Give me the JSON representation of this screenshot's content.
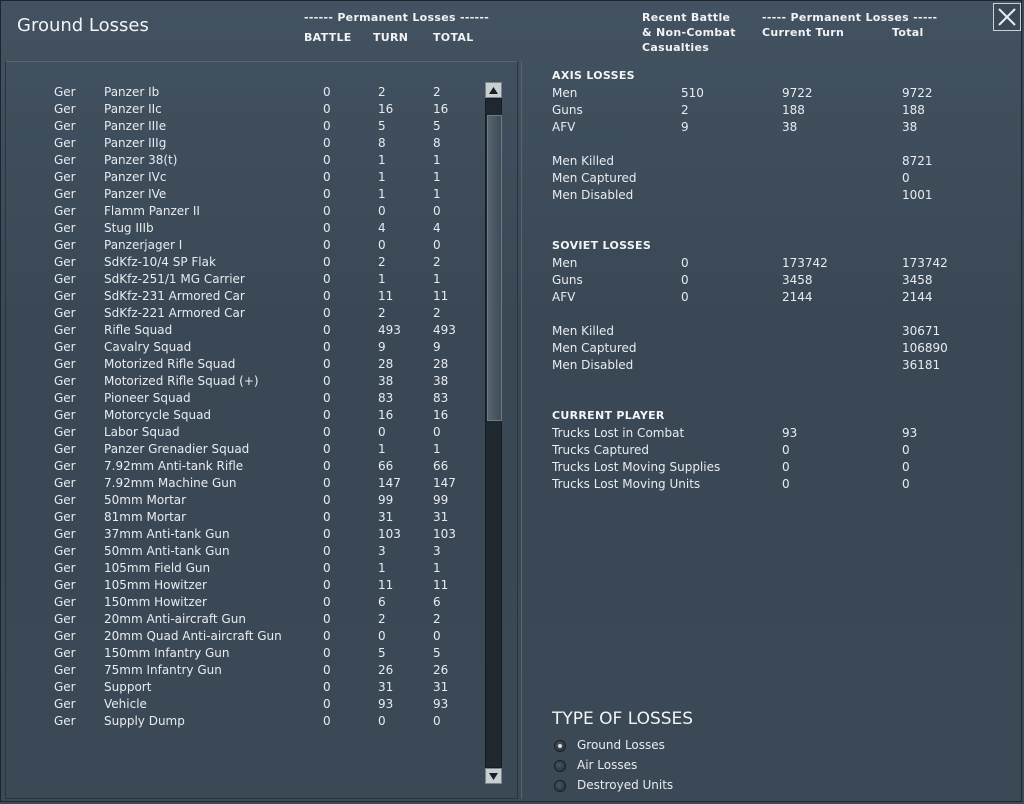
{
  "window": {
    "title": "Ground Losses"
  },
  "header": {
    "perm_losses_left": "------ Permanent Losses ------",
    "col_battle": "BATTLE",
    "col_turn": "TURN",
    "col_total": "TOTAL",
    "recent_line1": "Recent Battle",
    "recent_line2": "& Non-Combat",
    "recent_line3": "Casualties",
    "perm_losses_right": "----- Permanent Losses -----",
    "col_current_turn": "Current Turn",
    "col_total_right": "Total"
  },
  "close_icon": "close-icon",
  "units": [
    {
      "nation": "Ger",
      "name": "Panzer Ib",
      "battle": "0",
      "turn": "2",
      "total": "2"
    },
    {
      "nation": "Ger",
      "name": "Panzer IIc",
      "battle": "0",
      "turn": "16",
      "total": "16"
    },
    {
      "nation": "Ger",
      "name": "Panzer IIIe",
      "battle": "0",
      "turn": "5",
      "total": "5"
    },
    {
      "nation": "Ger",
      "name": "Panzer IIIg",
      "battle": "0",
      "turn": "8",
      "total": "8"
    },
    {
      "nation": "Ger",
      "name": "Panzer 38(t)",
      "battle": "0",
      "turn": "1",
      "total": "1"
    },
    {
      "nation": "Ger",
      "name": "Panzer IVc",
      "battle": "0",
      "turn": "1",
      "total": "1"
    },
    {
      "nation": "Ger",
      "name": "Panzer IVe",
      "battle": "0",
      "turn": "1",
      "total": "1"
    },
    {
      "nation": "Ger",
      "name": "Flamm Panzer II",
      "battle": "0",
      "turn": "0",
      "total": "0"
    },
    {
      "nation": "Ger",
      "name": "Stug IIIb",
      "battle": "0",
      "turn": "4",
      "total": "4"
    },
    {
      "nation": "Ger",
      "name": "Panzerjager I",
      "battle": "0",
      "turn": "0",
      "total": "0"
    },
    {
      "nation": "Ger",
      "name": "SdKfz-10/4 SP Flak",
      "battle": "0",
      "turn": "2",
      "total": "2"
    },
    {
      "nation": "Ger",
      "name": "SdKfz-251/1 MG Carrier",
      "battle": "0",
      "turn": "1",
      "total": "1"
    },
    {
      "nation": "Ger",
      "name": "SdKfz-231 Armored Car",
      "battle": "0",
      "turn": "11",
      "total": "11"
    },
    {
      "nation": "Ger",
      "name": "SdKfz-221 Armored Car",
      "battle": "0",
      "turn": "2",
      "total": "2"
    },
    {
      "nation": "Ger",
      "name": "Rifle Squad",
      "battle": "0",
      "turn": "493",
      "total": "493"
    },
    {
      "nation": "Ger",
      "name": "Cavalry Squad",
      "battle": "0",
      "turn": "9",
      "total": "9"
    },
    {
      "nation": "Ger",
      "name": "Motorized Rifle Squad",
      "battle": "0",
      "turn": "28",
      "total": "28"
    },
    {
      "nation": "Ger",
      "name": "Motorized Rifle Squad (+)",
      "battle": "0",
      "turn": "38",
      "total": "38"
    },
    {
      "nation": "Ger",
      "name": "Pioneer Squad",
      "battle": "0",
      "turn": "83",
      "total": "83"
    },
    {
      "nation": "Ger",
      "name": "Motorcycle Squad",
      "battle": "0",
      "turn": "16",
      "total": "16"
    },
    {
      "nation": "Ger",
      "name": "Labor Squad",
      "battle": "0",
      "turn": "0",
      "total": "0"
    },
    {
      "nation": "Ger",
      "name": "Panzer Grenadier Squad",
      "battle": "0",
      "turn": "1",
      "total": "1"
    },
    {
      "nation": "Ger",
      "name": "7.92mm Anti-tank Rifle",
      "battle": "0",
      "turn": "66",
      "total": "66"
    },
    {
      "nation": "Ger",
      "name": "7.92mm Machine Gun",
      "battle": "0",
      "turn": "147",
      "total": "147"
    },
    {
      "nation": "Ger",
      "name": "50mm Mortar",
      "battle": "0",
      "turn": "99",
      "total": "99"
    },
    {
      "nation": "Ger",
      "name": "81mm Mortar",
      "battle": "0",
      "turn": "31",
      "total": "31"
    },
    {
      "nation": "Ger",
      "name": "37mm Anti-tank Gun",
      "battle": "0",
      "turn": "103",
      "total": "103"
    },
    {
      "nation": "Ger",
      "name": "50mm Anti-tank Gun",
      "battle": "0",
      "turn": "3",
      "total": "3"
    },
    {
      "nation": "Ger",
      "name": "105mm Field Gun",
      "battle": "0",
      "turn": "1",
      "total": "1"
    },
    {
      "nation": "Ger",
      "name": "105mm Howitzer",
      "battle": "0",
      "turn": "11",
      "total": "11"
    },
    {
      "nation": "Ger",
      "name": "150mm Howitzer",
      "battle": "0",
      "turn": "6",
      "total": "6"
    },
    {
      "nation": "Ger",
      "name": "20mm Anti-aircraft Gun",
      "battle": "0",
      "turn": "2",
      "total": "2"
    },
    {
      "nation": "Ger",
      "name": "20mm Quad Anti-aircraft Gun",
      "battle": "0",
      "turn": "0",
      "total": "0"
    },
    {
      "nation": "Ger",
      "name": "150mm Infantry Gun",
      "battle": "0",
      "turn": "5",
      "total": "5"
    },
    {
      "nation": "Ger",
      "name": "75mm Infantry Gun",
      "battle": "0",
      "turn": "26",
      "total": "26"
    },
    {
      "nation": "Ger",
      "name": "Support",
      "battle": "0",
      "turn": "31",
      "total": "31"
    },
    {
      "nation": "Ger",
      "name": "Vehicle",
      "battle": "0",
      "turn": "93",
      "total": "93"
    },
    {
      "nation": "Ger",
      "name": "Supply Dump",
      "battle": "0",
      "turn": "0",
      "total": "0"
    }
  ],
  "axis": {
    "title": "AXIS LOSSES",
    "rows": [
      {
        "label": "Men",
        "battle": "510",
        "turn": "9722",
        "total": "9722"
      },
      {
        "label": "Guns",
        "battle": "2",
        "turn": "188",
        "total": "188"
      },
      {
        "label": "AFV",
        "battle": "9",
        "turn": "38",
        "total": "38"
      }
    ],
    "detail": [
      {
        "label": "Men Killed",
        "total": "8721"
      },
      {
        "label": "Men Captured",
        "total": "0"
      },
      {
        "label": "Men Disabled",
        "total": "1001"
      }
    ]
  },
  "soviet": {
    "title": "SOVIET LOSSES",
    "rows": [
      {
        "label": "Men",
        "battle": "0",
        "turn": "173742",
        "total": "173742"
      },
      {
        "label": "Guns",
        "battle": "0",
        "turn": "3458",
        "total": "3458"
      },
      {
        "label": "AFV",
        "battle": "0",
        "turn": "2144",
        "total": "2144"
      }
    ],
    "detail": [
      {
        "label": "Men Killed",
        "total": "30671"
      },
      {
        "label": "Men Captured",
        "total": "106890"
      },
      {
        "label": "Men Disabled",
        "total": "36181"
      }
    ]
  },
  "player": {
    "title": "CURRENT PLAYER",
    "rows": [
      {
        "label": "Trucks Lost in Combat",
        "turn": "93",
        "total": "93"
      },
      {
        "label": "Trucks Captured",
        "turn": "0",
        "total": "0"
      },
      {
        "label": "Trucks Lost Moving Supplies",
        "turn": "0",
        "total": "0"
      },
      {
        "label": "Trucks Lost Moving Units",
        "turn": "0",
        "total": "0"
      }
    ]
  },
  "type_of_losses": {
    "title": "TYPE OF LOSSES",
    "options": [
      {
        "label": "Ground Losses",
        "selected": true
      },
      {
        "label": "Air Losses",
        "selected": false
      },
      {
        "label": "Destroyed Units",
        "selected": false
      }
    ]
  }
}
